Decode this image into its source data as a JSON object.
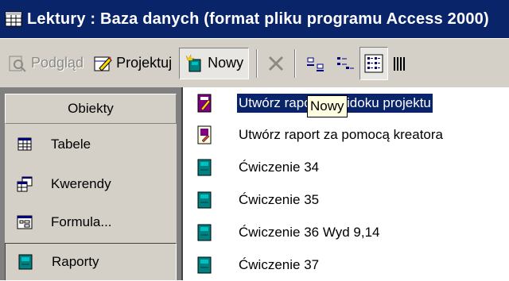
{
  "window": {
    "title": "Lektury : Baza danych (format pliku programu Access 2000)"
  },
  "toolbar": {
    "preview_label": "Podgląd",
    "design_label": "Projektuj",
    "new_label": "Nowy"
  },
  "sidebar": {
    "header": "Obiekty",
    "items": [
      {
        "label": "Tabele",
        "icon": "table-icon"
      },
      {
        "label": "Kwerendy",
        "icon": "query-icon"
      },
      {
        "label": "Formula...",
        "icon": "form-icon"
      },
      {
        "label": "Raporty",
        "icon": "report-icon",
        "selected": true
      }
    ]
  },
  "list": {
    "items": [
      {
        "label": "Utwórz raport w widoku projektu",
        "icon": "design-report-icon",
        "selected": true
      },
      {
        "label": "Utwórz raport za pomocą kreatora",
        "icon": "wizard-report-icon"
      },
      {
        "label": "Ćwiczenie 34",
        "icon": "report-icon"
      },
      {
        "label": "Ćwiczenie 35",
        "icon": "report-icon"
      },
      {
        "label": "Ćwiczenie 36 Wyd 9,14",
        "icon": "report-icon"
      },
      {
        "label": "Ćwiczenie 37",
        "icon": "report-icon"
      }
    ]
  },
  "tooltip": {
    "text": "Nowy"
  },
  "colors": {
    "titlebar": "#0a246a",
    "face": "#d4d0c8",
    "selection": "#0a246a",
    "tooltip_bg": "#ffffe1",
    "report_icon": "#008080"
  }
}
